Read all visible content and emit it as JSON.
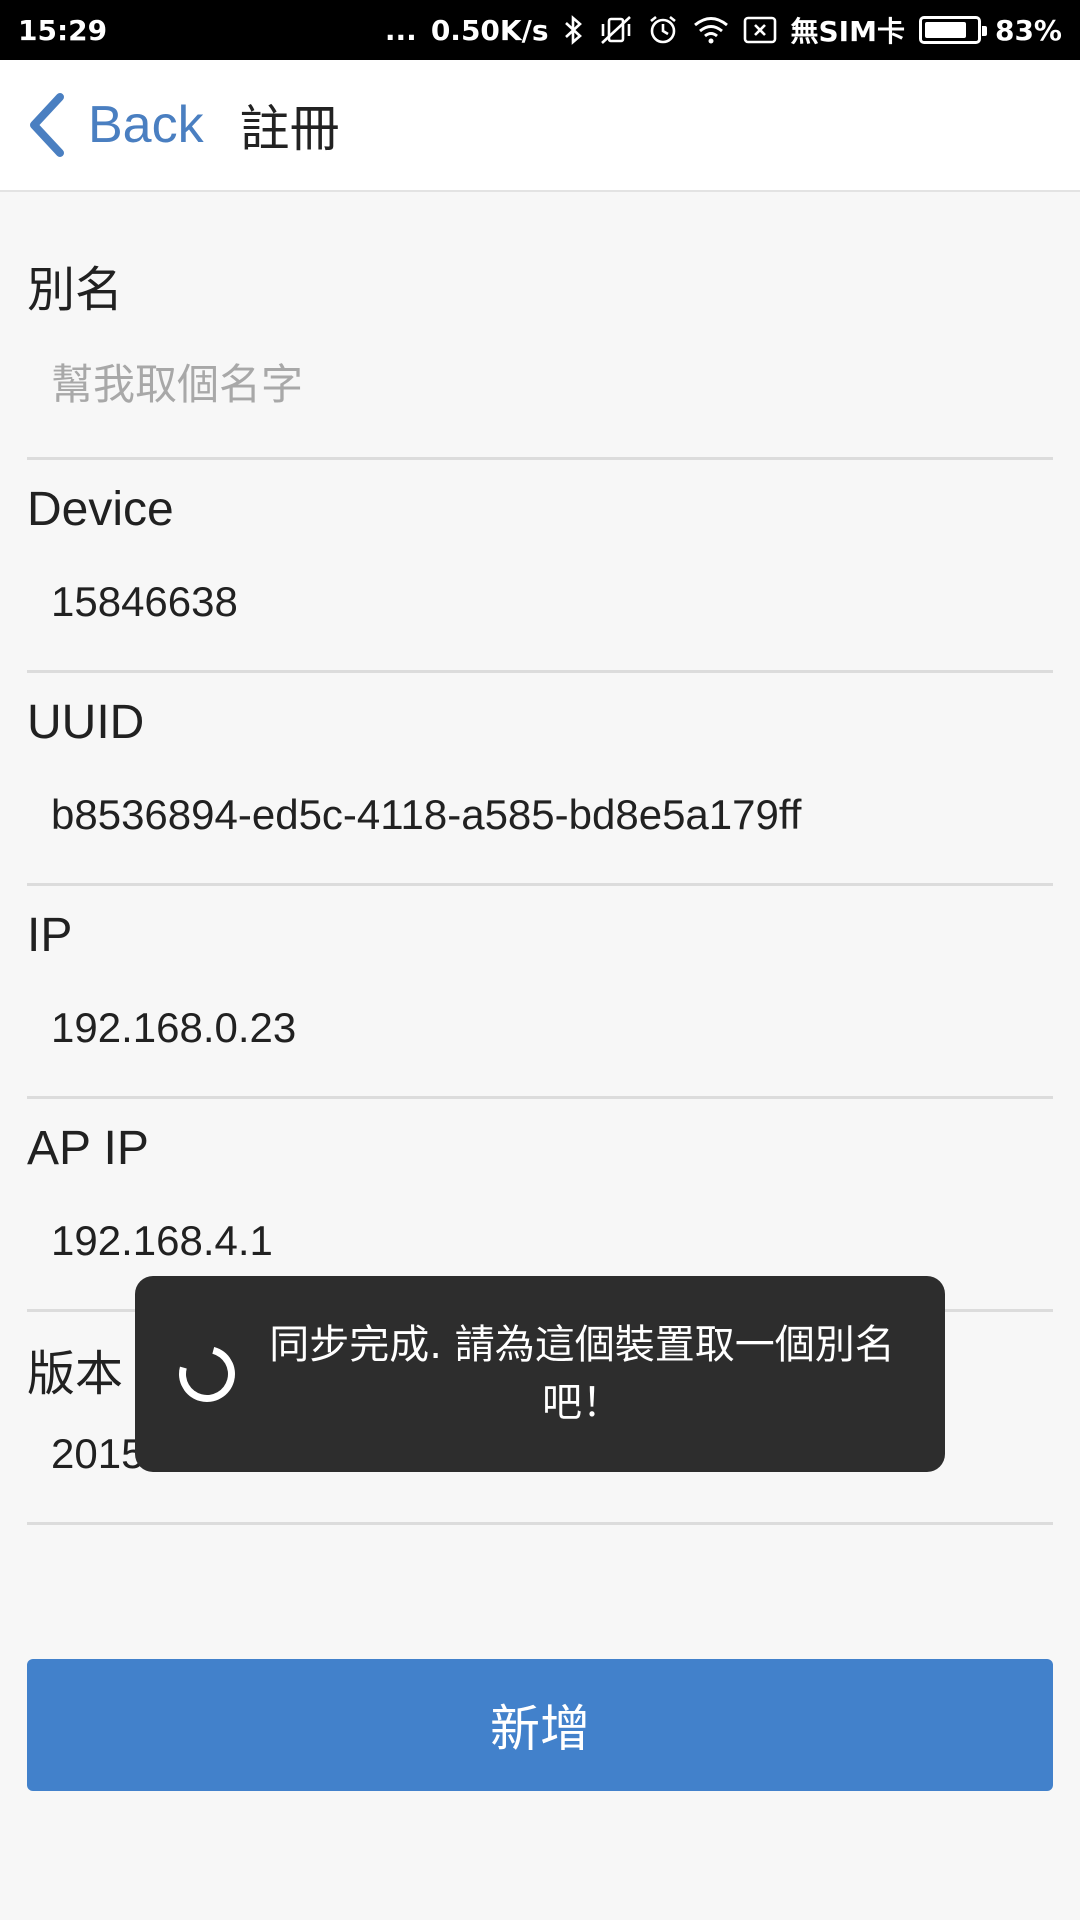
{
  "status_bar": {
    "time": "15:29",
    "dots": "...",
    "speed": "0.50K/s",
    "sim": "無SIM卡",
    "battery_percent": "83%",
    "battery_level": 0.83,
    "icons": [
      "bluetooth-icon",
      "vibrate-off-icon",
      "alarm-icon",
      "wifi-icon",
      "sim-x-icon",
      "battery-icon"
    ]
  },
  "nav": {
    "back_label": "Back",
    "title": "註冊"
  },
  "form": {
    "alias": {
      "label": "別名",
      "value": "",
      "placeholder": "幫我取個名字"
    },
    "device": {
      "label": "Device",
      "value": "15846638"
    },
    "uuid": {
      "label": "UUID",
      "value": "b8536894-ed5c-4118-a585-bd8e5a179ff"
    },
    "ip": {
      "label": "IP",
      "value": "192.168.0.23"
    },
    "ap_ip": {
      "label": "AP IP",
      "value": "192.168.4.1"
    },
    "version": {
      "label": "版本",
      "value": "2015.08.25"
    }
  },
  "add_button": {
    "label": "新增"
  },
  "toast": {
    "message": "同步完成. 請為這個裝置取一個別名吧！"
  },
  "colors": {
    "accent": "#4281cb",
    "back_link": "#4a7fc1",
    "toast_bg": "#2d2d2d"
  }
}
